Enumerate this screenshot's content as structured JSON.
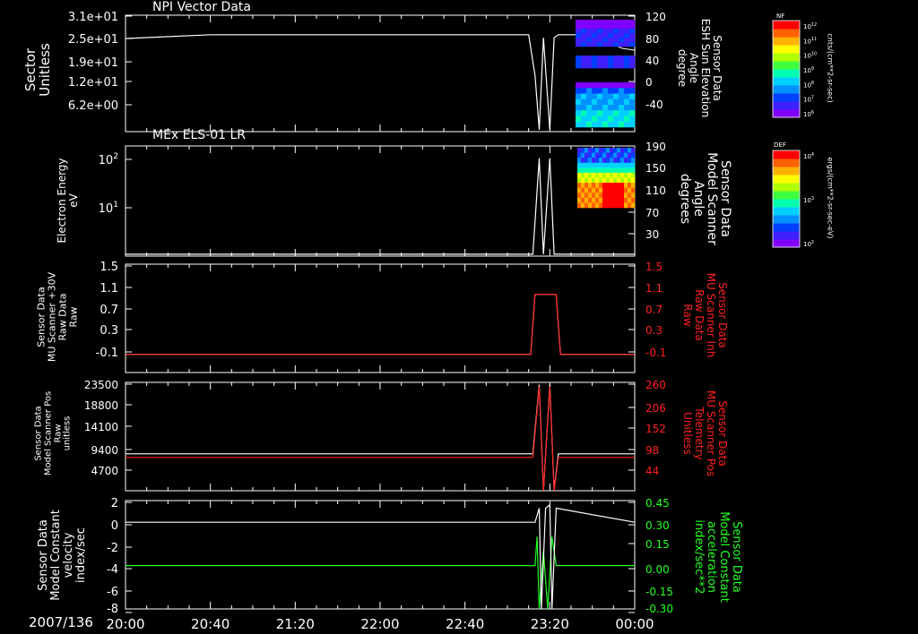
{
  "date_label": "2007/136",
  "x_ticks": [
    "20:00",
    "20:40",
    "21:20",
    "22:00",
    "22:40",
    "23:20",
    "00:00"
  ],
  "panels": [
    {
      "id": "p1",
      "title": "NPI Vector Data",
      "left_label": "Sector\nUnitless",
      "right_label": "Sensor Data\nESH Sun Elevation\nAngle\ndegree",
      "left_ticks": [
        "3.1e+01",
        "2.5e+01",
        "1.9e+01",
        "1.2e+01",
        "6.2e+00"
      ],
      "right_ticks": [
        "120",
        "80",
        "40",
        "0",
        "-40"
      ],
      "colorbar": {
        "title": "NF",
        "unit": "cnts/(cm**2-sr-sec)",
        "ticks": [
          "10^12",
          "10^11",
          "10^10",
          "10^9",
          "10^8",
          "10^7",
          "10^6"
        ]
      }
    },
    {
      "id": "p2",
      "title": "MEx ELS-01 LR",
      "left_label": "Electron Energy\neV",
      "right_label": "Sensor Data\nModel Scanner\nAngle\ndegrees",
      "left_ticks": [
        "10^2",
        "10^1"
      ],
      "right_ticks": [
        "190",
        "150",
        "110",
        "70",
        "30"
      ],
      "colorbar": {
        "title": "DEF",
        "unit": "ergs/(cm**2-sr-sec-eV)",
        "ticks": [
          "10^4",
          "10^3",
          "10^2"
        ]
      }
    },
    {
      "id": "p3",
      "left_label": "Sensor Data\nMU Scanner +30V\nRaw Data\nRaw",
      "right_label": "Sensor Data\nMU Scanner Inh\nRaw Data\nRaw",
      "left_ticks": [
        "1.5",
        "1.1",
        "0.7",
        "0.3",
        "-0.1"
      ],
      "right_ticks": [
        "1.5",
        "1.1",
        "0.7",
        "0.3",
        "-0.1"
      ]
    },
    {
      "id": "p4",
      "left_label": "Sensor Data\nModel Scanner Pos\nRaw\nunitless",
      "right_label": "Sensor Data\nMU Scanner Pos\nTelemetry\nUnitless",
      "left_ticks": [
        "23500",
        "18800",
        "14100",
        "9400",
        "4700"
      ],
      "right_ticks": [
        "260",
        "206",
        "152",
        "98",
        "44"
      ]
    },
    {
      "id": "p5",
      "left_label": "Sensor Data\nModel Constant\nvelocity\nindex/sec",
      "right_label": "Sensor Data\nModel Constant\nacceleration\nindex/sec**2",
      "left_ticks": [
        "2",
        "0",
        "-2",
        "-4",
        "-6",
        "-8"
      ],
      "right_ticks": [
        "0.45",
        "0.30",
        "0.15",
        "0.00",
        "-0.15",
        "-0.30"
      ]
    }
  ],
  "colors": {
    "white": "#ffffff",
    "red": "#ff2020",
    "green": "#20ff20",
    "bg": "#000000"
  },
  "chart_data": [
    {
      "type": "line",
      "title": "NPI Vector Data",
      "xlabel": "",
      "ylabel": "Sector Unitless",
      "y2label": "Sensor Data ESH Sun Elevation Angle degree",
      "xlim": [
        "20:00",
        "00:00"
      ],
      "ylim": [
        0,
        31
      ],
      "y2lim": [
        -70,
        120
      ],
      "series": [
        {
          "name": "Sector",
          "x": [
            "20:00",
            "20:40",
            "23:10",
            "23:13",
            "23:15",
            "23:17",
            "23:20",
            "23:22",
            "23:24",
            "00:00"
          ],
          "values": [
            24.8,
            25.8,
            25.8,
            15,
            0.5,
            25,
            0.5,
            25,
            25.8,
            25.8
          ]
        }
      ]
    },
    {
      "type": "line",
      "title": "MEx ELS-01 LR",
      "xlabel": "",
      "ylabel": "Electron Energy eV",
      "y2label": "Sensor Data Model Scanner Angle degrees",
      "xlim": [
        "20:00",
        "00:00"
      ],
      "y2lim": [
        10,
        190
      ],
      "series": [
        {
          "name": "Model Scanner Angle",
          "x": [
            "20:00",
            "23:12",
            "23:15",
            "23:17",
            "23:20",
            "23:22",
            "23:24",
            "00:00"
          ],
          "values": [
            13,
            13,
            170,
            13,
            170,
            13,
            13,
            13
          ]
        }
      ]
    },
    {
      "type": "line",
      "xlabel": "",
      "ylabel": "Sensor Data MU Scanner +30V Raw Data Raw",
      "y2label": "Sensor Data MU Scanner Inh Raw Data Raw",
      "xlim": [
        "20:00",
        "00:00"
      ],
      "ylim": [
        -0.3,
        1.5
      ],
      "series": [
        {
          "name": "MU Scanner +30V",
          "x": [
            "20:00",
            "23:11",
            "23:13",
            "23:23",
            "23:25",
            "00:00"
          ],
          "values": [
            0,
            0,
            1,
            1,
            0,
            0
          ]
        },
        {
          "name": "MU Scanner Inh",
          "x": [
            "20:00",
            "23:11",
            "23:13",
            "23:23",
            "23:25",
            "00:00"
          ],
          "values": [
            0,
            0,
            1,
            1,
            0,
            0
          ]
        }
      ]
    },
    {
      "type": "line",
      "xlabel": "",
      "ylabel": "Sensor Data Model Scanner Pos Raw unitless",
      "y2label": "Sensor Data MU Scanner Pos Telemetry Unitless",
      "xlim": [
        "20:00",
        "00:00"
      ],
      "ylim": [
        0,
        23500
      ],
      "series": [
        {
          "name": "Model Scanner Pos",
          "x": [
            "20:00",
            "23:12",
            "23:15",
            "23:17",
            "23:20",
            "23:22",
            "23:24",
            "00:00"
          ],
          "values": [
            8000,
            8000,
            23000,
            0,
            23000,
            0,
            8000,
            8000
          ]
        },
        {
          "name": "MU Scanner Pos",
          "x": [
            "20:00",
            "23:12",
            "23:15",
            "23:17",
            "23:20",
            "23:22",
            "23:24",
            "00:00"
          ],
          "values": [
            80,
            80,
            250,
            0,
            250,
            0,
            80,
            80
          ]
        }
      ]
    },
    {
      "type": "line",
      "xlabel": "",
      "ylabel": "Sensor Data Model Constant velocity index/sec",
      "y2label": "Sensor Data Model Constant acceleration index/sec**2",
      "xlim": [
        "20:00",
        "00:00"
      ],
      "ylim": [
        -8,
        2
      ],
      "y2lim": [
        -0.3,
        0.45
      ],
      "series": [
        {
          "name": "velocity",
          "x": [
            "20:00",
            "23:13",
            "23:15",
            "23:16",
            "23:18",
            "23:20",
            "23:21",
            "23:23",
            "00:00"
          ],
          "values": [
            0,
            0,
            1.3,
            -8,
            1.3,
            1.6,
            -8,
            1.3,
            0
          ]
        },
        {
          "name": "acceleration",
          "x": [
            "20:00",
            "23:13",
            "23:14",
            "23:15",
            "23:17",
            "23:19",
            "23:21",
            "23:23",
            "00:00"
          ],
          "values": [
            0,
            0,
            0.2,
            -0.3,
            0.1,
            -0.3,
            0.2,
            0,
            0
          ]
        }
      ]
    }
  ]
}
